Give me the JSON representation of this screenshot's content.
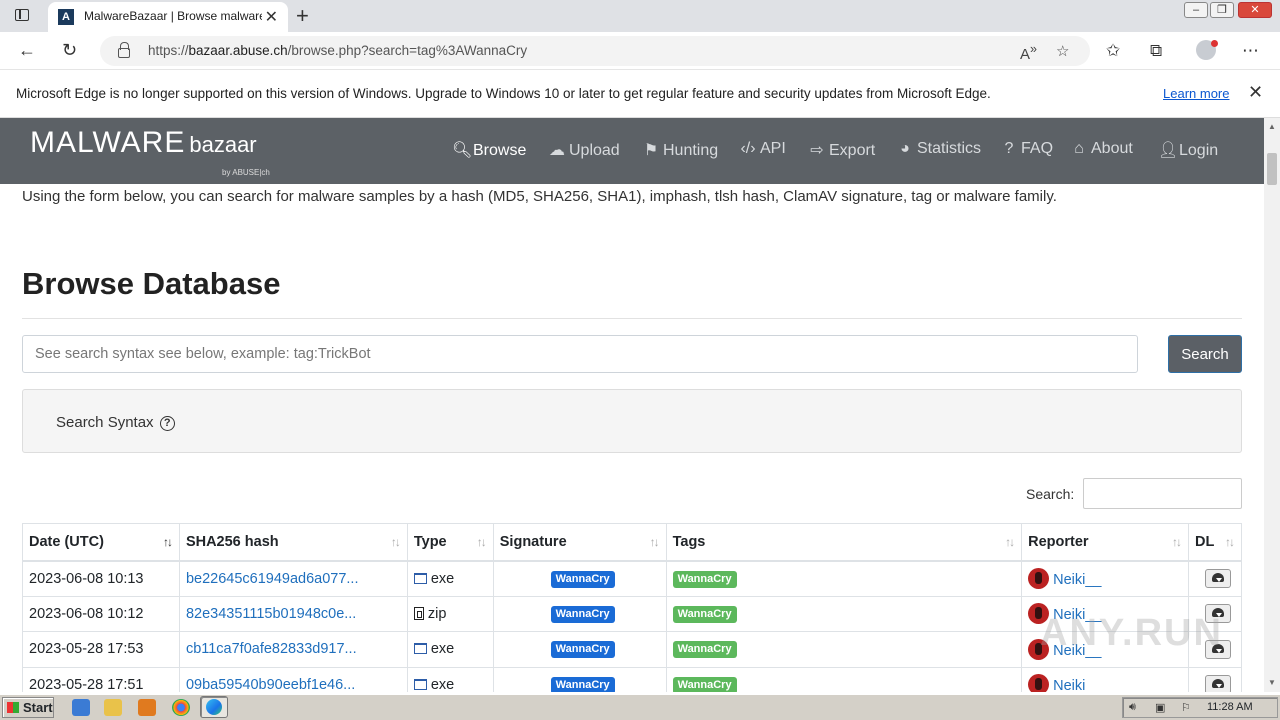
{
  "browser": {
    "tab_title": "MalwareBazaar | Browse malware",
    "tab_favicon_letter": "A",
    "url_host": "bazaar.abuse.ch",
    "url_prefix": "https://",
    "url_path": "/browse.php?search=tag%3AWannaCry",
    "info_message": "Microsoft Edge is no longer supported on this version of Windows. Upgrade to Windows 10 or later to get regular feature and security updates from Microsoft Edge.",
    "info_link": "Learn more"
  },
  "site": {
    "brand_big": "MALWARE",
    "brand_small": "bazaar",
    "brand_by": "by ABUSE|ch",
    "menu": [
      {
        "label": "Browse",
        "icon": "search-icon"
      },
      {
        "label": "Upload",
        "icon": "cloud-upload-icon"
      },
      {
        "label": "Hunting",
        "icon": "hunting-icon"
      },
      {
        "label": "API",
        "icon": "code-icon"
      },
      {
        "label": "Export",
        "icon": "export-icon"
      },
      {
        "label": "Statistics",
        "icon": "pie-chart-icon"
      },
      {
        "label": "FAQ",
        "icon": "question-icon"
      },
      {
        "label": "About",
        "icon": "building-icon"
      },
      {
        "label": "Login",
        "icon": "user-icon"
      }
    ]
  },
  "main": {
    "intro": "Using the form below, you can search for malware samples by a hash (MD5, SHA256, SHA1), imphash, tlsh hash, ClamAV signature, tag or malware family.",
    "heading": "Browse Database",
    "search_placeholder": "See search syntax see below, example: tag:TrickBot",
    "search_button": "Search",
    "syntax_label": "Search Syntax",
    "filter_label": "Search:"
  },
  "table": {
    "columns": [
      "Date (UTC)",
      "SHA256 hash",
      "Type",
      "Signature",
      "Tags",
      "Reporter",
      "DL"
    ],
    "rows": [
      {
        "date": "2023-06-08 10:13",
        "hash": "be22645c61949ad6a077...",
        "type": "exe",
        "signature": "WannaCry",
        "tag": "WannaCry",
        "reporter": "Neiki__"
      },
      {
        "date": "2023-06-08 10:12",
        "hash": "82e34351115b01948c0e...",
        "type": "zip",
        "signature": "WannaCry",
        "tag": "WannaCry",
        "reporter": "Neiki__"
      },
      {
        "date": "2023-05-28 17:53",
        "hash": "cb11ca7f0afe82833d917...",
        "type": "exe",
        "signature": "WannaCry",
        "tag": "WannaCry",
        "reporter": "Neiki__"
      },
      {
        "date": "2023-05-28 17:51",
        "hash": "09ba59540b90eebf1e46...",
        "type": "exe",
        "signature": "WannaCry",
        "tag": "WannaCry",
        "reporter": "Neiki"
      }
    ]
  },
  "taskbar": {
    "start": "Start",
    "clock": "11:28 AM"
  },
  "watermark": "ANY.RUN",
  "colors": {
    "navbar": "#5c6166",
    "signature_badge": "#1a6bd6",
    "tag_badge": "#5cb85c",
    "link": "#1f6fbd"
  }
}
